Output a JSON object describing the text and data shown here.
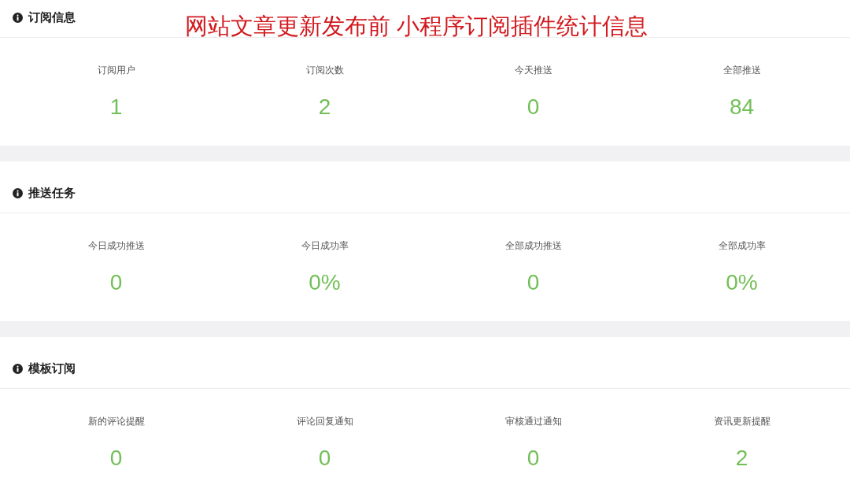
{
  "annotation": "网站文章更新发布前 小程序订阅插件统计信息",
  "sections": [
    {
      "title": "订阅信息",
      "stats": [
        {
          "label": "订阅用户",
          "value": "1"
        },
        {
          "label": "订阅次数",
          "value": "2"
        },
        {
          "label": "今天推送",
          "value": "0"
        },
        {
          "label": "全部推送",
          "value": "84"
        }
      ]
    },
    {
      "title": "推送任务",
      "stats": [
        {
          "label": "今日成功推送",
          "value": "0"
        },
        {
          "label": "今日成功率",
          "value": "0%"
        },
        {
          "label": "全部成功推送",
          "value": "0"
        },
        {
          "label": "全部成功率",
          "value": "0%"
        }
      ]
    },
    {
      "title": "模板订阅",
      "stats": [
        {
          "label": "新的评论提醒",
          "value": "0"
        },
        {
          "label": "评论回复通知",
          "value": "0"
        },
        {
          "label": "审核通过通知",
          "value": "0"
        },
        {
          "label": "资讯更新提醒",
          "value": "2"
        }
      ]
    }
  ]
}
